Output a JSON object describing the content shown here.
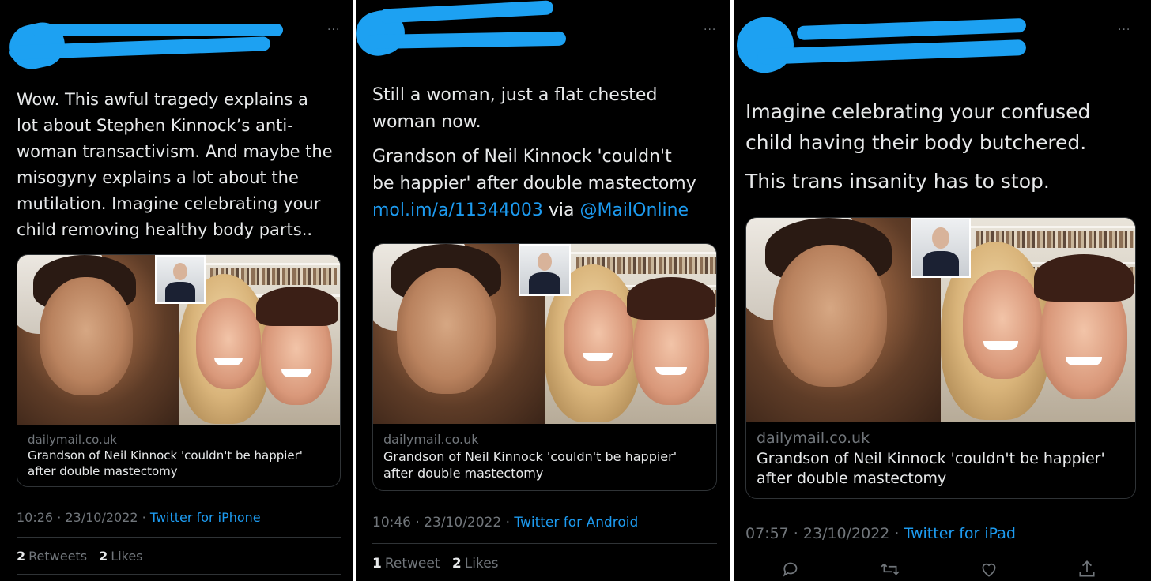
{
  "screens": [
    {
      "more_icon": "···",
      "text_lines": [
        "Wow. This awful tragedy explains a",
        "lot about Stephen Kinnock’s anti-",
        "woman transactivism. And maybe the",
        "misogyny explains a lot about the",
        "mutilation. Imagine celebrating your",
        "child removing healthy body parts.."
      ],
      "card": {
        "domain": "dailymail.co.uk",
        "title_line1": "Grandson of Neil Kinnock 'couldn't be happier'",
        "title_line2": "after double mastectomy"
      },
      "time": "10:26 · 23/10/2022 · ",
      "source": "Twitter for iPhone",
      "stats": [
        {
          "count": "2",
          "label": "Retweets"
        },
        {
          "count": "2",
          "label": "Likes"
        }
      ]
    },
    {
      "more_icon": "···",
      "text_lines": [
        "Still a woman, just a flat chested",
        "woman now."
      ],
      "quote_lines": [
        " Grandson of Neil Kinnock 'couldn't",
        "be happier' after double mastectomy"
      ],
      "link_url": "mol.im/a/11344003",
      "link_via": " via ",
      "link_handle": "@MailOnline",
      "card": {
        "domain": "dailymail.co.uk",
        "title_line1": "Grandson of Neil Kinnock 'couldn't be happier'",
        "title_line2": "after double mastectomy"
      },
      "time": "10:46 · 23/10/2022 · ",
      "source": "Twitter for Android",
      "stats": [
        {
          "count": "1",
          "label": "Retweet"
        },
        {
          "count": "2",
          "label": "Likes"
        }
      ]
    },
    {
      "more_icon": "···",
      "text_lines": [
        "Imagine celebrating your confused",
        "child having their body butchered."
      ],
      "text_line3": "This trans insanity has to stop.",
      "card": {
        "domain": "dailymail.co.uk",
        "title_line1": "Grandson of Neil Kinnock 'couldn't be happier'",
        "title_line2": "after double mastectomy"
      },
      "time": "07:57 · 23/10/2022 · ",
      "source": "Twitter for iPad",
      "actions": [
        "reply-icon",
        "retweet-icon",
        "like-icon",
        "share-icon"
      ]
    }
  ],
  "colors": {
    "background": "#000000",
    "redaction": "#1da1f2",
    "link": "#1d9bf0",
    "muted": "#71767b",
    "text": "#e7e9ea"
  }
}
